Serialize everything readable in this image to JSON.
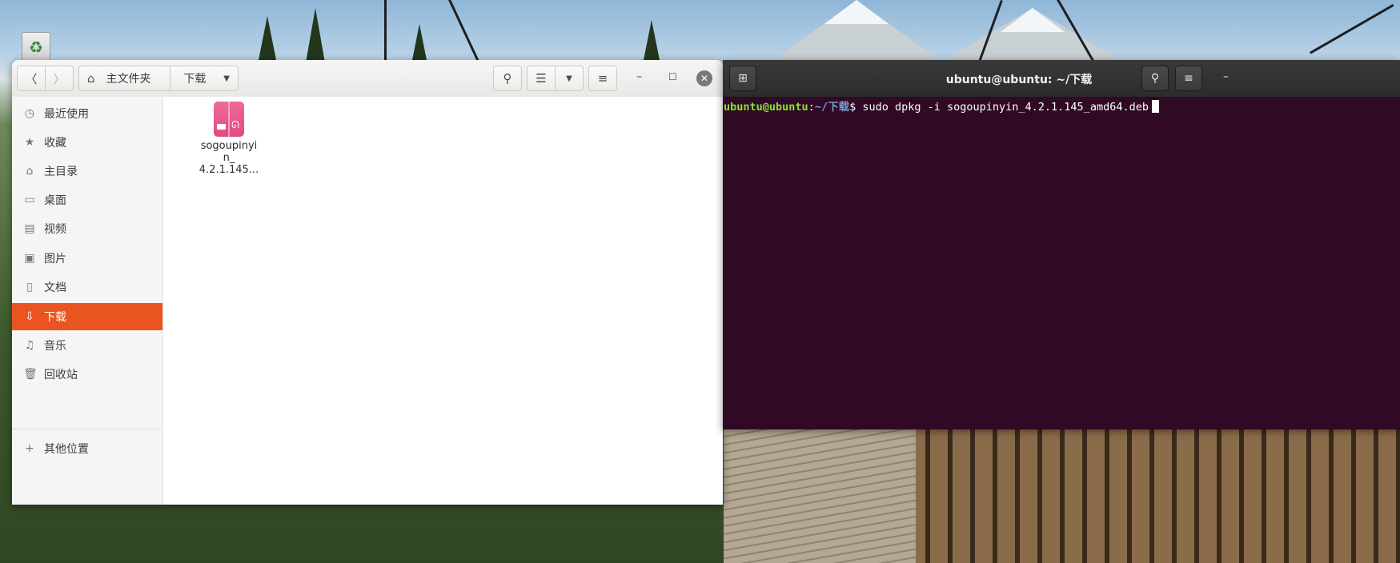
{
  "file_manager": {
    "path": {
      "home_label": "主文件夹",
      "current_label": "下载"
    },
    "sidebar": {
      "items": [
        {
          "label": "最近使用",
          "icon": "clock-icon"
        },
        {
          "label": "收藏",
          "icon": "star-icon"
        },
        {
          "label": "主目录",
          "icon": "home-icon"
        },
        {
          "label": "桌面",
          "icon": "desktop-icon"
        },
        {
          "label": "视频",
          "icon": "video-icon"
        },
        {
          "label": "图片",
          "icon": "picture-icon"
        },
        {
          "label": "文档",
          "icon": "document-icon"
        },
        {
          "label": "下载",
          "icon": "download-icon",
          "active": true
        },
        {
          "label": "音乐",
          "icon": "music-icon"
        },
        {
          "label": "回收站",
          "icon": "trash-icon"
        },
        {
          "label": "其他位置",
          "icon": "plus-icon"
        }
      ]
    },
    "files": [
      {
        "name_line1": "sogoupinyi",
        "name_line2": "n_",
        "name_line3": "4.2.1.145...",
        "icon": "deb-package-icon"
      }
    ],
    "accent_color": "#e95420"
  },
  "terminal": {
    "title": "ubuntu@ubuntu: ~/下载",
    "prompt_user": "ubuntu@ubuntu",
    "prompt_colon": ":",
    "prompt_path": "~/下载",
    "prompt_symbol": "$ ",
    "command": "sudo dpkg -i sogoupinyin_4.2.1.145_amd64.deb",
    "background_color": "#300a24"
  }
}
